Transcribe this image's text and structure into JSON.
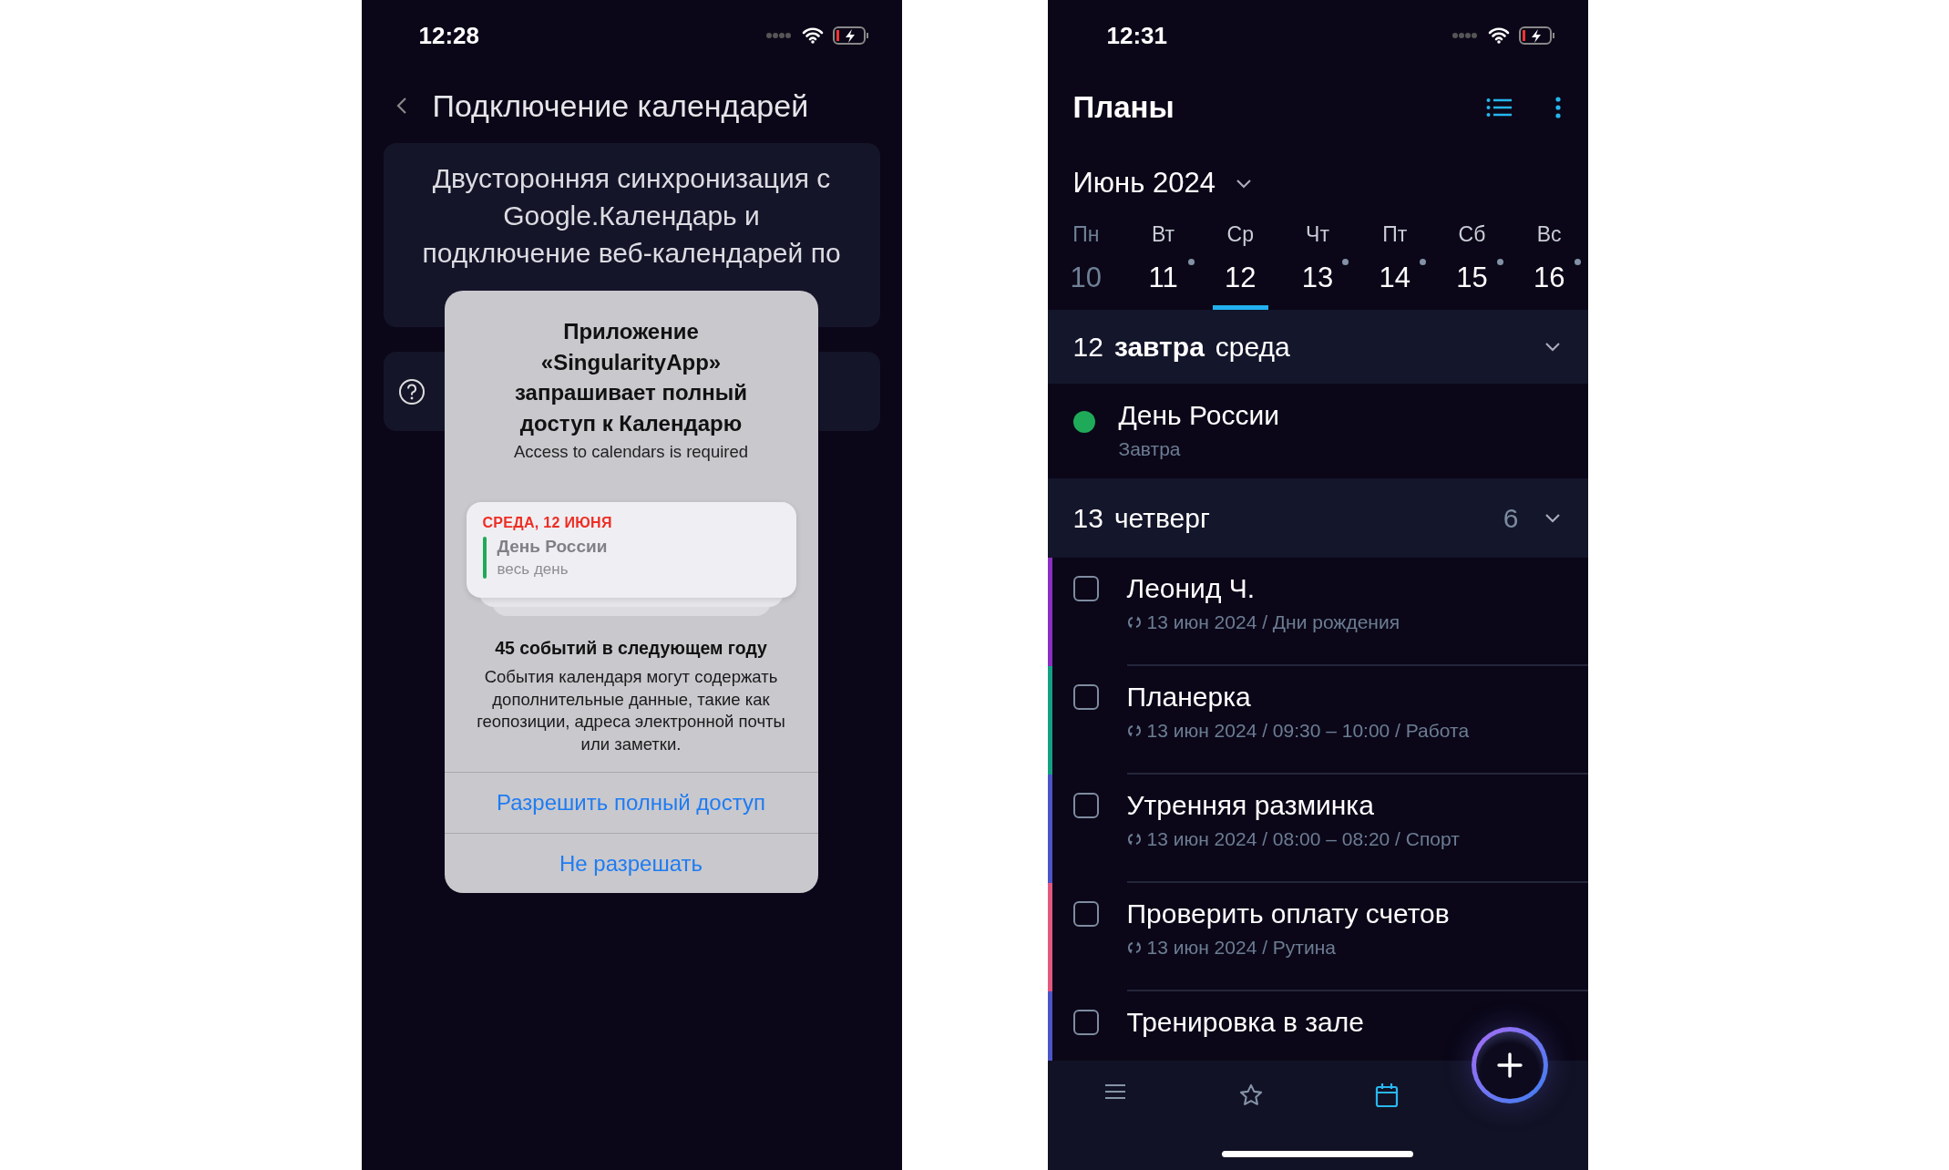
{
  "left_screen": {
    "status_bar": {
      "time": "12:28"
    },
    "header": {
      "title": "Подключение календарей"
    },
    "promo_card": {
      "lines": [
        "Двусторонняя синхронизация с",
        "Google.Календарь и",
        "подключение веб-календарей по"
      ]
    },
    "dialog": {
      "title": "Приложение «SingularityApp» запрашивает полный доступ к Календарю",
      "subtitle": "Access to calendars is required",
      "preview": {
        "date": "СРЕДА, 12 ИЮНЯ",
        "event": "День России",
        "time": "весь день",
        "color": "#1faa59"
      },
      "stats_title": "45 событий в следующем году",
      "stats_text": "События календаря могут содержать дополнительные данные, такие как геопозиции, адреса электронной почты или заметки.",
      "buttons": [
        {
          "label": "Разрешить полный доступ"
        },
        {
          "label": "Не разрешать"
        }
      ]
    }
  },
  "right_screen": {
    "status_bar": {
      "time": "12:31"
    },
    "header": {
      "title": "Планы"
    },
    "month": "Июнь 2024",
    "week": [
      {
        "weekday": "Пн",
        "day": "10",
        "selected": false,
        "past": true,
        "has_events": false
      },
      {
        "weekday": "Вт",
        "day": "11",
        "selected": false,
        "past": false,
        "has_events": true
      },
      {
        "weekday": "Ср",
        "day": "12",
        "selected": true,
        "past": false,
        "has_events": false
      },
      {
        "weekday": "Чт",
        "day": "13",
        "selected": false,
        "past": false,
        "has_events": true
      },
      {
        "weekday": "Пт",
        "day": "14",
        "selected": false,
        "past": false,
        "has_events": true
      },
      {
        "weekday": "Сб",
        "day": "15",
        "selected": false,
        "past": false,
        "has_events": true
      },
      {
        "weekday": "Вс",
        "day": "16",
        "selected": false,
        "past": false,
        "has_events": true
      }
    ],
    "sections": [
      {
        "day": "12",
        "relative": "завтра",
        "weekday": "среда",
        "items": [
          {
            "kind": "event",
            "title": "День России",
            "subtitle": "Завтра",
            "color": "#1faa59"
          }
        ]
      },
      {
        "day": "13",
        "weekday": "четверг",
        "count": "6",
        "items": [
          {
            "kind": "task",
            "title": "Леонид Ч.",
            "meta": "13 июн 2024 / Дни рождения",
            "checked": false,
            "color": "#8a2fc4"
          },
          {
            "kind": "task",
            "title": "Планерка",
            "meta": "13 июн 2024 / 09:30 – 10:00 / Работа",
            "checked": false,
            "color": "#16a083"
          },
          {
            "kind": "task",
            "title": "Утренняя разминка",
            "meta": "13 июн 2024 / 08:00 – 08:20 / Спорт",
            "checked": false,
            "color": "#4b55c6"
          },
          {
            "kind": "task",
            "title": "Проверить оплату счетов",
            "meta": "13 июн 2024 / Рутина",
            "checked": false,
            "color": "#e2587f"
          },
          {
            "kind": "task",
            "title": "Тренировка в зале",
            "checked": false,
            "color": "#4b55c6"
          }
        ]
      }
    ],
    "bottom_nav": [
      {
        "kind": "menu",
        "selected": false
      },
      {
        "kind": "favorites",
        "selected": false
      },
      {
        "kind": "calendar",
        "selected": true
      }
    ]
  }
}
